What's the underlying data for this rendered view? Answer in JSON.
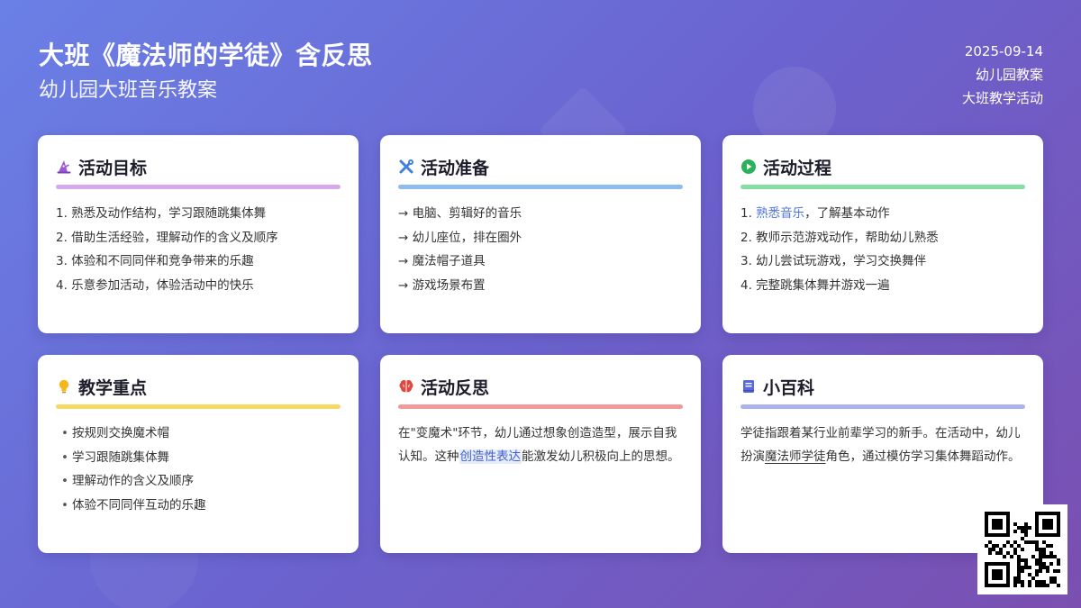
{
  "header": {
    "title": "大班《魔法师的学徒》含反思",
    "subtitle": "幼儿园大班音乐教案"
  },
  "meta": {
    "date": "2025-09-14",
    "category": "幼儿园教案",
    "tag": "大班教学活动"
  },
  "cards": {
    "goals": {
      "title": "活动目标",
      "icon": "wizard-hat-icon",
      "items": [
        "1. 熟悉及动作结构，学习跟随跳集体舞",
        "2. 借助生活经验，理解动作的含义及顺序",
        "3. 体验和不同同伴和竞争带来的乐趣",
        "4. 乐意参加活动，体验活动中的快乐"
      ]
    },
    "preparation": {
      "title": "活动准备",
      "icon": "tools-icon",
      "items": [
        "→ 电脑、剪辑好的音乐",
        "→ 幼儿座位，排在圈外",
        "→ 魔法帽子道具",
        "→ 游戏场景布置"
      ]
    },
    "process": {
      "title": "活动过程",
      "icon": "play-circle-icon",
      "item1_num": "1. ",
      "item1_link": "熟悉音乐",
      "item1_rest": "，了解基本动作",
      "items": [
        "2. 教师示范游戏动作，帮助幼儿熟悉",
        "3. 幼儿尝试玩游戏，学习交换舞伴",
        "4. 完整跳集体舞并游戏一遍"
      ]
    },
    "keypoints": {
      "title": "教学重点",
      "icon": "lightbulb-icon",
      "bullet": "•",
      "items": [
        "按规则交换魔术帽",
        "学习跟随跳集体舞",
        "理解动作的含义及顺序",
        "体验不同同伴互动的乐趣"
      ]
    },
    "reflection": {
      "title": "活动反思",
      "icon": "brain-icon",
      "text_part1": "在\"变魔术\"环节，幼儿通过想象创造造型，展示自我认知。这种",
      "text_mark": "创造性表达",
      "text_part2": "能激发幼儿积极向上的思想。"
    },
    "wiki": {
      "title": "小百科",
      "icon": "book-icon",
      "text_part1": "学徒指跟着某行业前辈学习的新手。在活动中，幼儿扮演",
      "text_uline": "魔法师学徒",
      "text_part2": "角色，通过模仿学习集体舞蹈动作。"
    }
  },
  "colors": {
    "bg_start": "#6a80e6",
    "bg_end": "#7a4fb0",
    "goals": "#d7a8ec",
    "preparation": "#8fbcee",
    "process": "#86dfa2",
    "keypoints": "#f6d862",
    "reflection": "#ee9b9b",
    "wiki": "#aab3ea"
  }
}
